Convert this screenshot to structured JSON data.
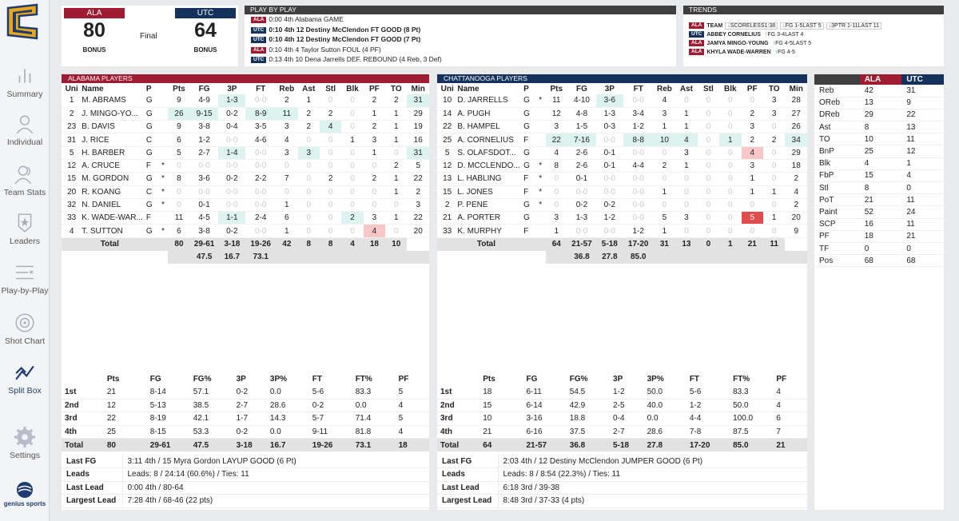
{
  "colors": {
    "ala": "#9e1b32",
    "utc": "#14325c",
    "highlight": "#dcf3f0",
    "bad": "#f7c6c6",
    "worst": "#e24b4b"
  },
  "sidebar": {
    "items": [
      {
        "label": "Summary",
        "icon": "bar-chart-icon"
      },
      {
        "label": "Individual",
        "icon": "person-icon"
      },
      {
        "label": "Team Stats",
        "icon": "team-icon"
      },
      {
        "label": "Leaders",
        "icon": "star-badge-icon"
      },
      {
        "label": "Play-by-Play",
        "icon": "list-icon"
      },
      {
        "label": "Shot Chart",
        "icon": "target-icon"
      },
      {
        "label": "Split Box",
        "icon": "trend-icon"
      },
      {
        "label": "Settings",
        "icon": "gear-icon"
      }
    ],
    "brand": "genius sports"
  },
  "score": {
    "home_abbr": "ALA",
    "home_score": "80",
    "away_abbr": "UTC",
    "away_score": "64",
    "status": "Final",
    "home_bonus": "BONUS",
    "away_bonus": "BONUS"
  },
  "pbp": {
    "title": "PLAY BY PLAY",
    "rows": [
      {
        "team": "ALA",
        "text": "0:00 4th Alabama GAME",
        "bold": false
      },
      {
        "team": "UTC",
        "text": "0:10 4th 12 Destiny McClendon FT GOOD (8 Pt)",
        "bold": true
      },
      {
        "team": "UTC",
        "text": "0:10 4th 12 Destiny McClendon FT GOOD (7 Pt)",
        "bold": true
      },
      {
        "team": "ALA",
        "text": "0:10 4th 4 Taylor Sutton FOUL (4 PF)",
        "bold": false
      },
      {
        "team": "UTC",
        "text": "0:13 4th 10 Dena Jarrells DEF. REBOUND (4 Reb, 3 Def)",
        "bold": false
      }
    ]
  },
  "trends": {
    "title": "TRENDS",
    "rows": [
      {
        "team": "ALA",
        "label": "TEAM",
        "chips": [
          {
            "dir": "dn",
            "text": "SCORELESS1:38"
          },
          {
            "dir": "dn",
            "text": "FG 1-5LAST 5"
          },
          {
            "dir": "dn",
            "text": "3PTR 1-11LAST 11"
          }
        ]
      },
      {
        "team": "UTC",
        "label": "ABBEY CORNELIUS",
        "chips": [
          {
            "dir": "up",
            "text": "FG 3-4LAST 4"
          }
        ]
      },
      {
        "team": "ALA",
        "label": "JAMYA MINGO-YOUNG",
        "chips": [
          {
            "dir": "up",
            "text": "FG 4-5LAST 5"
          }
        ]
      },
      {
        "team": "ALA",
        "label": "KHYLA WADE-WARREN",
        "chips": [
          {
            "dir": "up",
            "text": "FG 4-5"
          }
        ]
      }
    ]
  },
  "columns": [
    "Uni",
    "Name",
    "P",
    "",
    "Pts",
    "FG",
    "3P",
    "FT",
    "Reb",
    "Ast",
    "Stl",
    "Blk",
    "PF",
    "TO",
    "Min"
  ],
  "alabama": {
    "title": "ALABAMA PLAYERS",
    "players": [
      [
        "1",
        "M. ABRAMS",
        "G",
        "",
        "9",
        "4-9",
        "1-3",
        "0-0",
        "2",
        "1",
        "0",
        "0",
        "2",
        "2",
        "31"
      ],
      [
        "2",
        "J. MINGO-YO...",
        "G",
        "",
        "26",
        "9-15",
        "0-2",
        "8-9",
        "11",
        "2",
        "2",
        "0",
        "1",
        "1",
        "29"
      ],
      [
        "23",
        "B. DAVIS",
        "G",
        "",
        "9",
        "3-8",
        "0-4",
        "3-5",
        "3",
        "2",
        "4",
        "0",
        "2",
        "1",
        "19"
      ],
      [
        "31",
        "J. RICE",
        "C",
        "",
        "6",
        "1-2",
        "0-0",
        "4-6",
        "4",
        "0",
        "0",
        "1",
        "3",
        "1",
        "16"
      ],
      [
        "5",
        "H. BARBER",
        "G",
        "",
        "5",
        "2-7",
        "1-4",
        "0-0",
        "3",
        "3",
        "0",
        "0",
        "1",
        "0",
        "31"
      ],
      [
        "12",
        "A. CRUCE",
        "F",
        "*",
        "0",
        "0-0",
        "0-0",
        "0-0",
        "0",
        "0",
        "0",
        "0",
        "0",
        "2",
        "5"
      ],
      [
        "15",
        "M. GORDON",
        "G",
        "*",
        "8",
        "3-6",
        "0-2",
        "2-2",
        "7",
        "0",
        "2",
        "0",
        "2",
        "1",
        "22"
      ],
      [
        "20",
        "R. KOANG",
        "C",
        "*",
        "0",
        "0-0",
        "0-0",
        "0-0",
        "0",
        "0",
        "0",
        "0",
        "0",
        "1",
        "2"
      ],
      [
        "32",
        "N. DANIEL",
        "G",
        "*",
        "0",
        "0-1",
        "0-0",
        "0-0",
        "1",
        "0",
        "0",
        "0",
        "0",
        "0",
        "3"
      ],
      [
        "33",
        "K. WADE-WAR...",
        "F",
        "",
        "11",
        "4-5",
        "1-1",
        "2-4",
        "6",
        "0",
        "0",
        "2",
        "3",
        "1",
        "22"
      ],
      [
        "4",
        "T. SUTTON",
        "G",
        "*",
        "6",
        "3-8",
        "0-2",
        "0-0",
        "1",
        "0",
        "0",
        "0",
        "4",
        "0",
        "20"
      ]
    ],
    "total": [
      "Total",
      "80",
      "29-61",
      "3-18",
      "19-26",
      "42",
      "8",
      "8",
      "4",
      "18",
      "10"
    ],
    "pct": [
      "47.5",
      "16.7",
      "73.1"
    ],
    "quarters": {
      "head": [
        "",
        "Pts",
        "FG",
        "FG%",
        "3P",
        "3P%",
        "FT",
        "FT%",
        "PF"
      ],
      "rows": [
        [
          "1st",
          "21",
          "8-14",
          "57.1",
          "0-2",
          "0.0",
          "5-6",
          "83.3",
          "5"
        ],
        [
          "2nd",
          "12",
          "5-13",
          "38.5",
          "2-7",
          "28.6",
          "0-2",
          "0.0",
          "4"
        ],
        [
          "3rd",
          "22",
          "8-19",
          "42.1",
          "1-7",
          "14.3",
          "5-7",
          "71.4",
          "5"
        ],
        [
          "4th",
          "25",
          "8-15",
          "53.3",
          "0-2",
          "0.0",
          "9-11",
          "81.8",
          "4"
        ]
      ],
      "total": [
        "Total",
        "80",
        "29-61",
        "47.5",
        "3-18",
        "16.7",
        "19-26",
        "73.1",
        "18"
      ]
    },
    "info": [
      [
        "Last FG",
        "3:11 4th / 15 Myra Gordon LAYUP GOOD (6 Pt)"
      ],
      [
        "Leads",
        "Leads: 8 / 24:14 (60.6%) / Ties: 11"
      ],
      [
        "Last Lead",
        "0:00 4th / 80-64"
      ],
      [
        "Largest Lead",
        "7:28 4th / 68-46 (22 pts)"
      ]
    ]
  },
  "chattanooga": {
    "title": "CHATTANOOGA PLAYERS",
    "players": [
      [
        "10",
        "D. JARRELLS",
        "G",
        "*",
        "11",
        "4-10",
        "3-6",
        "0-0",
        "4",
        "0",
        "0",
        "0",
        "0",
        "3",
        "28"
      ],
      [
        "14",
        "A. PUGH",
        "G",
        "",
        "12",
        "4-8",
        "1-3",
        "3-4",
        "3",
        "1",
        "0",
        "0",
        "2",
        "3",
        "27"
      ],
      [
        "22",
        "B. HAMPEL",
        "G",
        "",
        "3",
        "1-5",
        "0-3",
        "1-2",
        "1",
        "1",
        "0",
        "0",
        "3",
        "0",
        "26"
      ],
      [
        "25",
        "A. CORNELIUS",
        "F",
        "",
        "22",
        "7-16",
        "0-0",
        "8-8",
        "10",
        "4",
        "0",
        "1",
        "2",
        "2",
        "34"
      ],
      [
        "5",
        "S. OLAFSDOT...",
        "G",
        "",
        "4",
        "2-6",
        "0-1",
        "0-0",
        "0",
        "3",
        "0",
        "0",
        "4",
        "0",
        "29"
      ],
      [
        "12",
        "D. MCCLENDO...",
        "G",
        "*",
        "8",
        "2-6",
        "0-1",
        "4-4",
        "2",
        "1",
        "0",
        "0",
        "3",
        "0",
        "18"
      ],
      [
        "13",
        "L. HABLING",
        "F",
        "*",
        "0",
        "0-1",
        "0-0",
        "0-0",
        "0",
        "0",
        "0",
        "0",
        "1",
        "0",
        "2"
      ],
      [
        "15",
        "L. JONES",
        "F",
        "*",
        "0",
        "0-0",
        "0-0",
        "0-0",
        "1",
        "0",
        "0",
        "0",
        "1",
        "1",
        "4"
      ],
      [
        "2",
        "P. PENE",
        "G",
        "*",
        "0",
        "0-2",
        "0-2",
        "0-0",
        "0",
        "0",
        "0",
        "0",
        "0",
        "0",
        "2"
      ],
      [
        "21",
        "A. PORTER",
        "G",
        "",
        "3",
        "1-3",
        "1-2",
        "0-0",
        "5",
        "3",
        "0",
        "0",
        "5",
        "1",
        "20"
      ],
      [
        "33",
        "K. MURPHY",
        "F",
        "",
        "1",
        "0-0",
        "0-0",
        "1-2",
        "1",
        "0",
        "0",
        "0",
        "0",
        "0",
        "9"
      ]
    ],
    "total": [
      "Total",
      "64",
      "21-57",
      "5-18",
      "17-20",
      "31",
      "13",
      "0",
      "1",
      "21",
      "11"
    ],
    "pct": [
      "36.8",
      "27.8",
      "85.0"
    ],
    "quarters": {
      "head": [
        "",
        "Pts",
        "FG",
        "FG%",
        "3P",
        "3P%",
        "FT",
        "FT%",
        "PF"
      ],
      "rows": [
        [
          "1st",
          "18",
          "6-11",
          "54.5",
          "1-2",
          "50.0",
          "5-6",
          "83.3",
          "4"
        ],
        [
          "2nd",
          "15",
          "6-14",
          "42.9",
          "2-5",
          "40.0",
          "1-2",
          "50.0",
          "4"
        ],
        [
          "3rd",
          "10",
          "3-16",
          "18.8",
          "0-4",
          "0.0",
          "4-4",
          "100.0",
          "6"
        ],
        [
          "4th",
          "21",
          "6-16",
          "37.5",
          "2-7",
          "28.6",
          "7-8",
          "87.5",
          "7"
        ]
      ],
      "total": [
        "Total",
        "64",
        "21-57",
        "36.8",
        "5-18",
        "27.8",
        "17-20",
        "85.0",
        "21"
      ]
    },
    "info": [
      [
        "Last FG",
        "2:03 4th / 12 Destiny McClendon JUMPER GOOD (6 Pt)"
      ],
      [
        "Leads",
        "Leads: 8 / 8:54 (22.3%) / Ties: 11"
      ],
      [
        "Last Lead",
        "6:18 3rd / 39-38"
      ],
      [
        "Largest Lead",
        "8:48 3rd / 37-33 (4 pts)"
      ]
    ]
  },
  "compare": {
    "head": [
      "",
      "ALA",
      "UTC"
    ],
    "rows": [
      [
        "Reb",
        "42",
        "31"
      ],
      [
        "OReb",
        "13",
        "9"
      ],
      [
        "DReb",
        "29",
        "22"
      ],
      [
        "Ast",
        "8",
        "13"
      ],
      [
        "TO",
        "10",
        "11"
      ],
      [
        "BnP",
        "25",
        "12"
      ],
      [
        "Blk",
        "4",
        "1"
      ],
      [
        "FbP",
        "15",
        "4"
      ],
      [
        "Stl",
        "8",
        "0"
      ],
      [
        "PoT",
        "21",
        "11"
      ],
      [
        "Paint",
        "52",
        "24"
      ],
      [
        "SCP",
        "16",
        "11"
      ],
      [
        "PF",
        "18",
        "21"
      ],
      [
        "TF",
        "0",
        "0"
      ],
      [
        "Pos",
        "68",
        "68"
      ]
    ]
  }
}
